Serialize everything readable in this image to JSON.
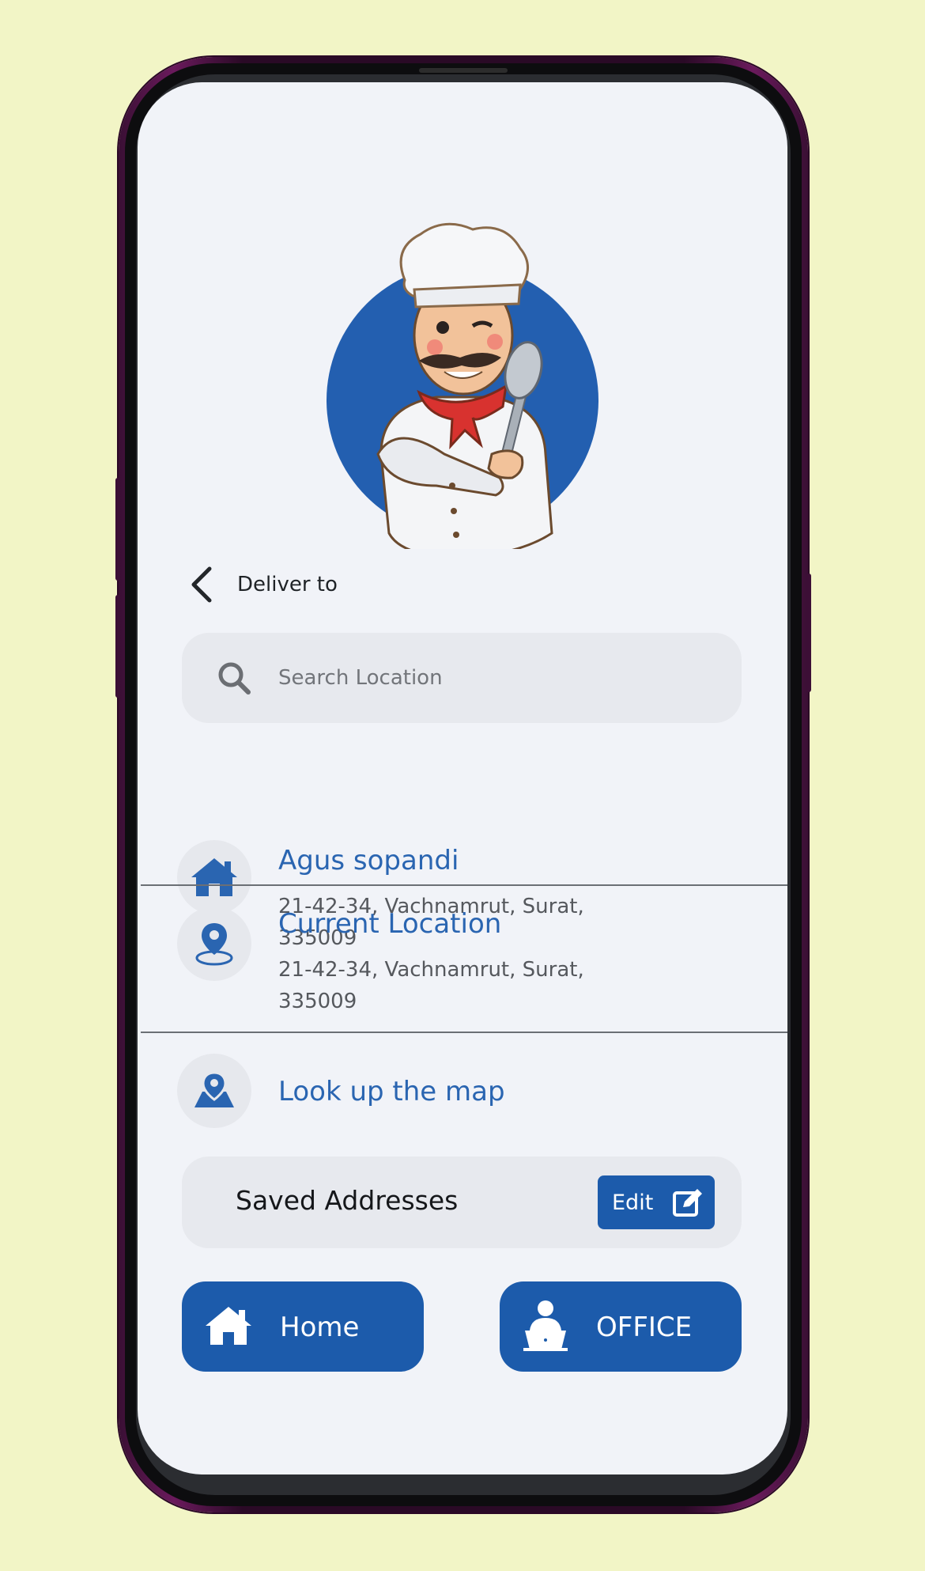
{
  "header": {
    "title": "Deliver to"
  },
  "search": {
    "placeholder": "Search Location"
  },
  "addresses": [
    {
      "title": "Agus sopandi",
      "line1": "21-42-34, Vachnamrut, Surat,",
      "line2": "335009",
      "icon": "home-icon"
    },
    {
      "title": "Current Location",
      "line1": "21-42-34, Vachnamrut, Surat,",
      "line2": "335009",
      "icon": "location-pin-icon"
    }
  ],
  "map_link": {
    "label": "Look up the map",
    "icon": "map-pin-icon"
  },
  "saved": {
    "label": "Saved Addresses",
    "edit_label": "Edit"
  },
  "buttons": {
    "home": "Home",
    "office": "OFFICE"
  },
  "colors": {
    "accent": "#1c5bab",
    "background": "#f2f5c6",
    "screen": "#f1f3f8",
    "title_blue": "#2a65b1"
  }
}
